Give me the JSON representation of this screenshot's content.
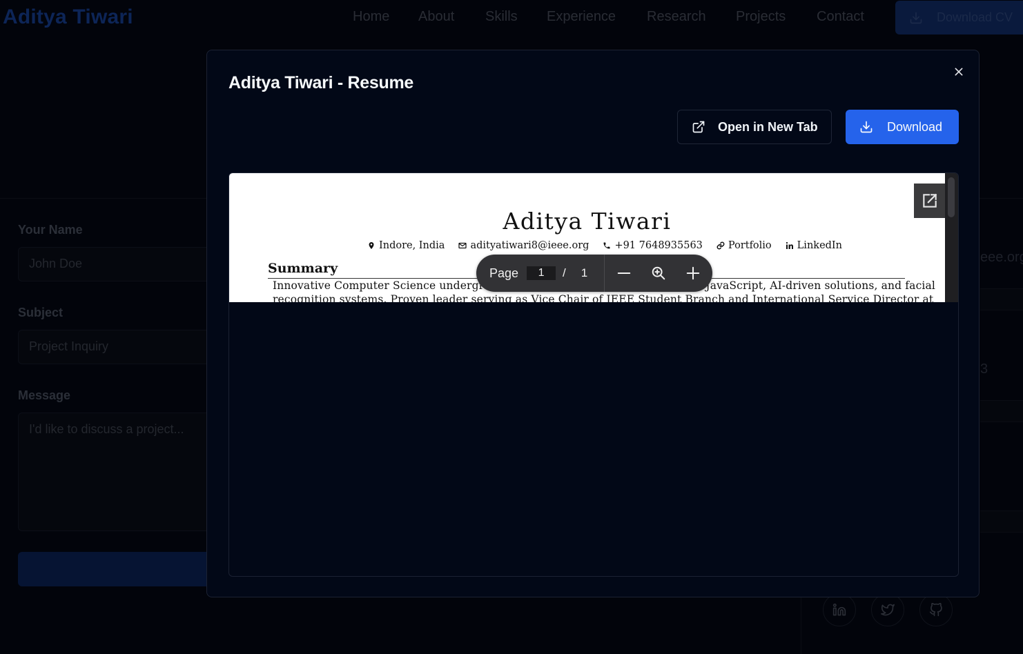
{
  "background": {
    "logo": "Aditya Tiwari",
    "nav": [
      "Home",
      "About",
      "Skills",
      "Experience",
      "Research",
      "Projects",
      "Contact"
    ],
    "cv_button": "Download CV",
    "form": {
      "name_label": "Your Name",
      "name_placeholder": "John Doe",
      "subject_label": "Subject",
      "subject_placeholder": "Project Inquiry",
      "message_label": "Message",
      "message_placeholder": "I'd like to discuss a project..."
    },
    "side_email_fragment": "eee.org",
    "side_phone_fragment": "3"
  },
  "modal": {
    "title": "Aditya Tiwari - Resume",
    "open_new_tab": "Open in New Tab",
    "download": "Download",
    "close_icon": "close-icon"
  },
  "pdf": {
    "name": "Aditya Tiwari",
    "contacts": {
      "location": "Indore, India",
      "email": "adityatiwari8@ieee.org",
      "phone": "+91 7648935563",
      "portfolio": "Portfolio",
      "linkedin": "LinkedIn"
    },
    "section_title": "Summary",
    "summary_line1": "Innovative Computer Science undergraduate at AITR with expertise in React, JavaScript, AI-driven solutions, and facial",
    "summary_line2": "recognition systems. Proven leader serving as Vice Chair of IEEE Student Branch and International Service Director at"
  },
  "toolbar": {
    "page_label": "Page",
    "current_page": "1",
    "separator": "/",
    "total_pages": "1"
  },
  "colors": {
    "accent": "#2563eb",
    "modal_bg": "#020817",
    "toolbar_bg": "#323235"
  }
}
